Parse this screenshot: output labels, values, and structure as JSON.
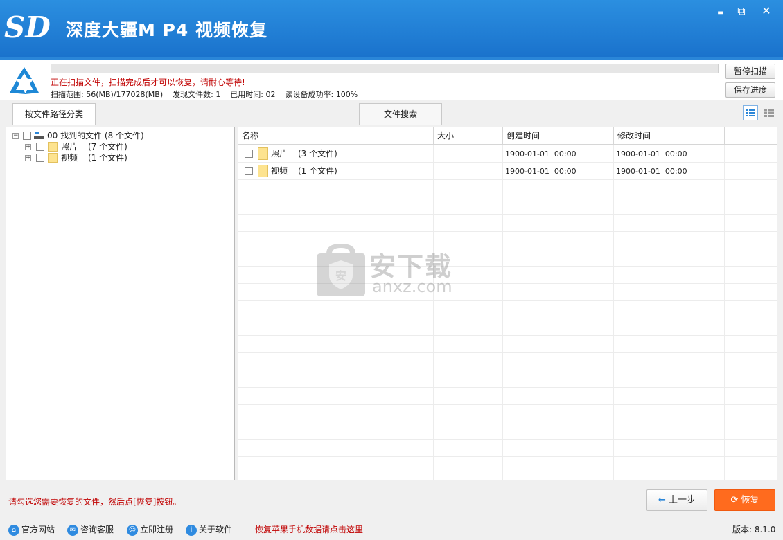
{
  "window": {
    "title": "深度大疆M P4 视频恢复",
    "logo_text": "SD",
    "minimize_glyph": "▬",
    "restore_glyph": "⧉",
    "close_glyph": "✕"
  },
  "scan": {
    "status": "正在扫描文件，扫描完成后才可以恢复，请耐心等待!",
    "stats": "扫描范围: 56(MB)/177028(MB)    发现文件数: 1    已用时间: 02    读设备成功率: 100%",
    "progress_fraction": 0.0,
    "pause_label": "暂停扫描",
    "save_label": "保存进度"
  },
  "tabs": {
    "path_tab": "按文件路径分类",
    "search_tab": "文件搜索"
  },
  "tree": {
    "root_label": "00 找到的文件 (8 个文件)",
    "children": [
      {
        "label": "照片",
        "count": "(7 个文件)"
      },
      {
        "label": "视频",
        "count": "(1 个文件)"
      }
    ]
  },
  "table": {
    "headers": [
      "名称",
      "大小",
      "创建时间",
      "修改时间"
    ],
    "rows": [
      {
        "name": "照片",
        "count": "(3 个文件)",
        "size": "",
        "created": "1900-01-01  00:00",
        "modified": "1900-01-01  00:00"
      },
      {
        "name": "视频",
        "count": "(1 个文件)",
        "size": "",
        "created": "1900-01-01  00:00",
        "modified": "1900-01-01  00:00"
      }
    ]
  },
  "watermark": {
    "text": "安下载",
    "url": "anxz.com",
    "shield_char": "安"
  },
  "footer": {
    "hint": "请勾选您需要恢复的文件，然后点[恢复]按钮。",
    "prev_label": "上一步",
    "recover_label": "恢复",
    "links": [
      "官方网站",
      "咨询客服",
      "立即注册",
      "关于软件"
    ],
    "promo": "恢复苹果手机数据请点击这里",
    "version": "版本: 8.1.0"
  },
  "colors": {
    "title_bar": "#1a72cc",
    "accent": "#2a86d8",
    "warning_text": "#c00000",
    "recover_button": "#ff6b1e"
  }
}
